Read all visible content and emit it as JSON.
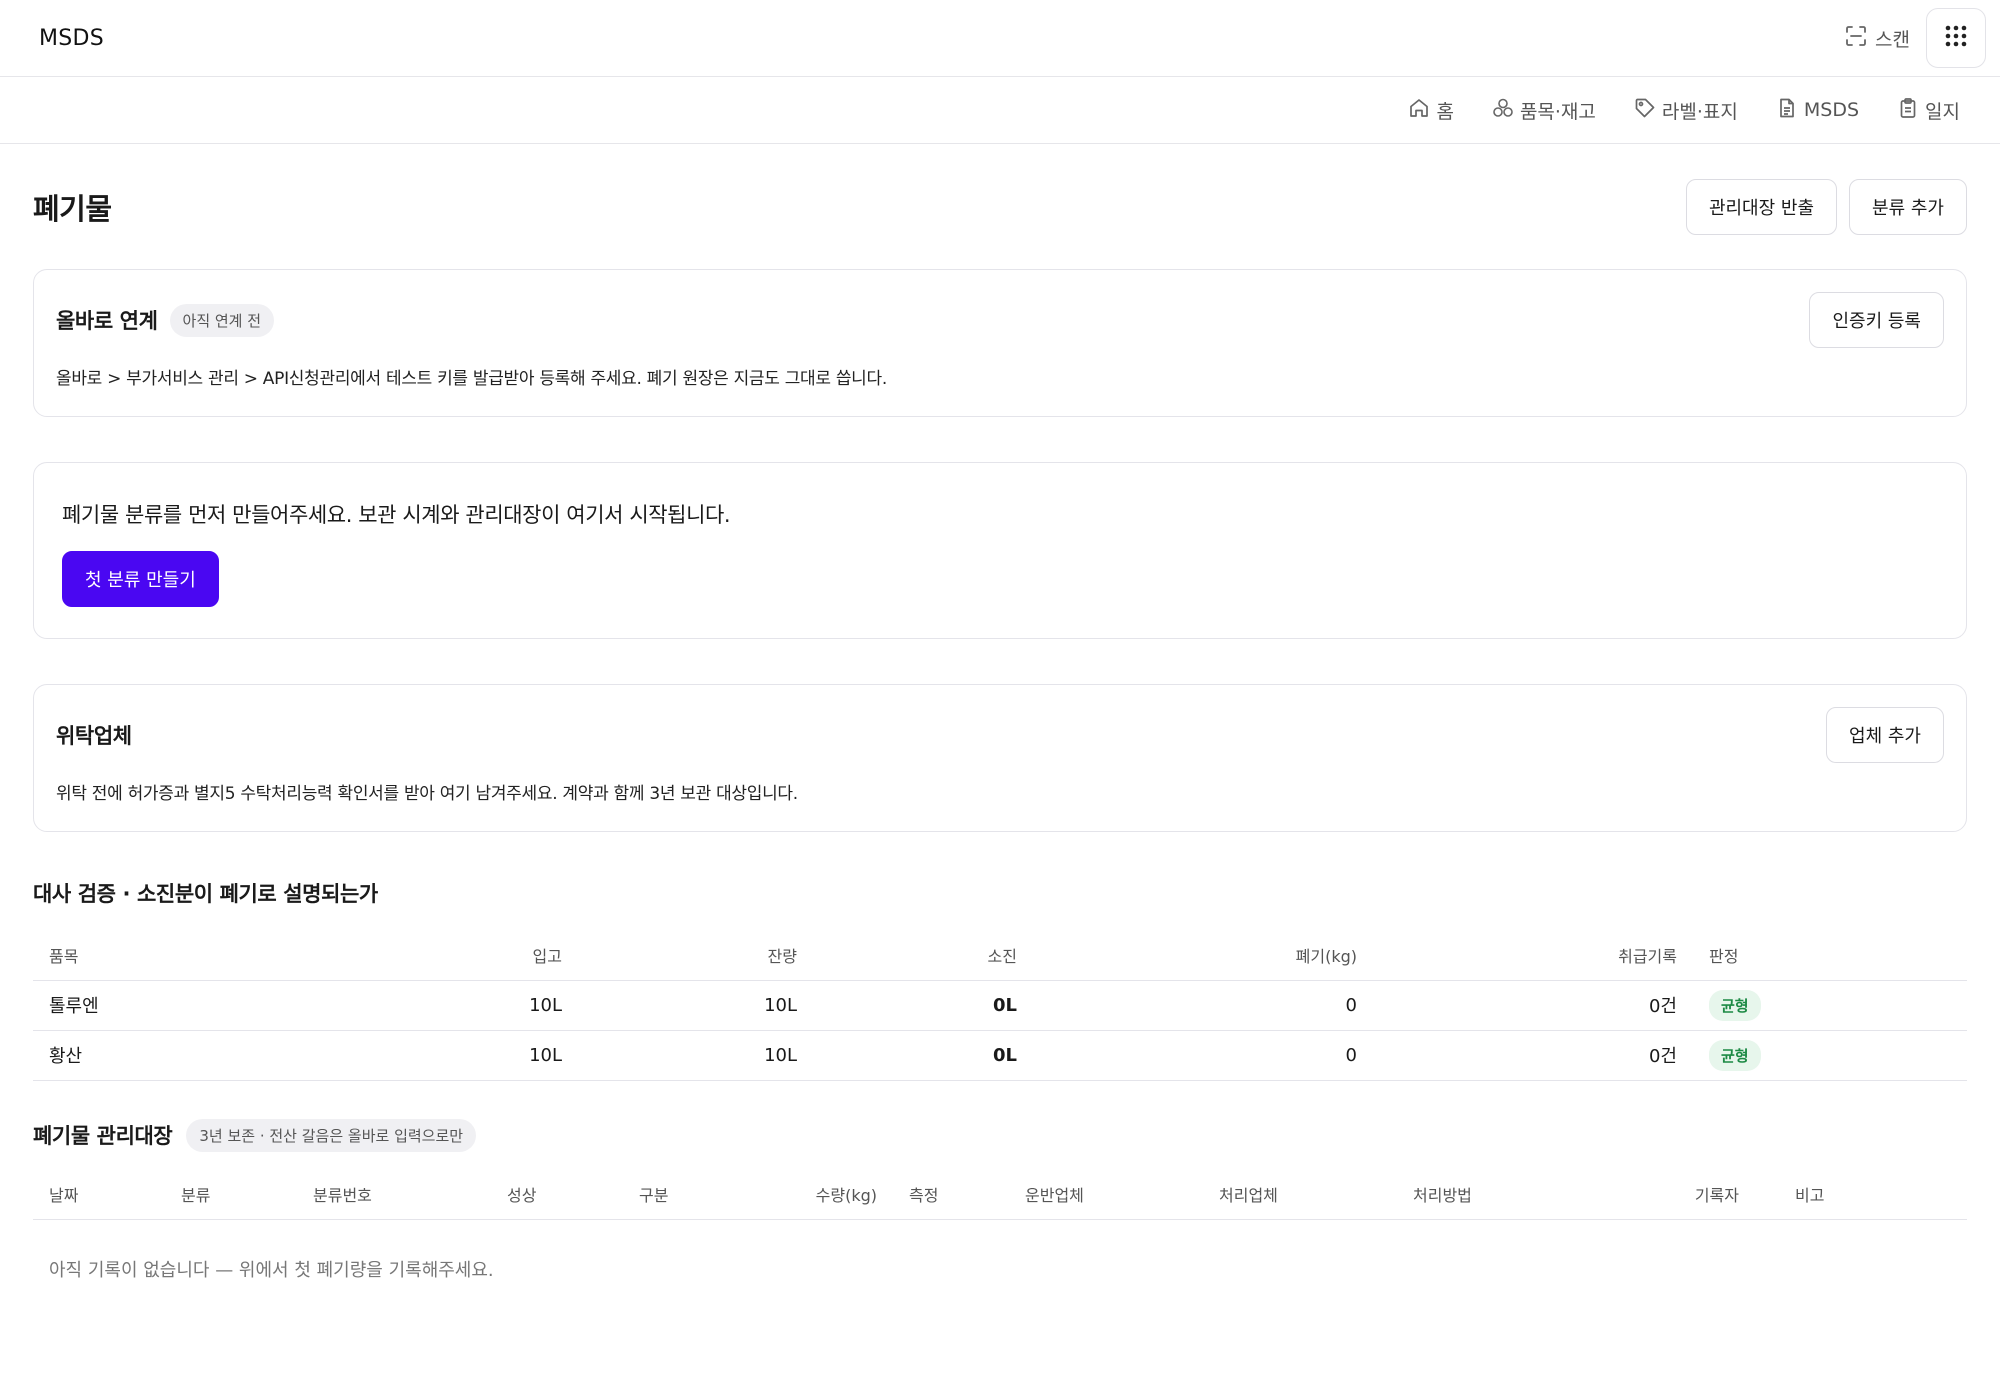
{
  "app": {
    "brand": "MSDS",
    "scan_label": "스캔"
  },
  "nav": {
    "items": [
      {
        "label": "홈",
        "icon": "home-icon"
      },
      {
        "label": "품목·재고",
        "icon": "boxes-icon"
      },
      {
        "label": "라벨·표지",
        "icon": "tag-icon"
      },
      {
        "label": "MSDS",
        "icon": "document-icon"
      },
      {
        "label": "일지",
        "icon": "clipboard-icon"
      }
    ]
  },
  "page": {
    "title": "폐기물",
    "export_label": "관리대장 반출",
    "add_category_label": "분류 추가"
  },
  "allbaro": {
    "title": "올바로 연계",
    "status": "아직 연계 전",
    "register_label": "인증키 등록",
    "description": "올바로 > 부가서비스 관리 > API신청관리에서 테스트 키를 발급받아 등록해 주세요. 폐기 원장은 지금도 그대로 씁니다."
  },
  "empty_category": {
    "message": "폐기물 분류를 먼저 만들어주세요. 보관 시계와 관리대장이 여기서 시작됩니다.",
    "cta_label": "첫 분류 만들기"
  },
  "vendor": {
    "title": "위탁업체",
    "add_label": "업체 추가",
    "description": "위탁 전에 허가증과 별지5 수탁처리능력 확인서를 받아 여기 남겨주세요. 계약과 함께 3년 보관 대상입니다."
  },
  "balance": {
    "title": "대사 검증 · 소진분이 폐기로 설명되는가",
    "headers": [
      "품목",
      "입고",
      "잔량",
      "소진",
      "폐기(kg)",
      "취급기록",
      "판정"
    ],
    "rows": [
      {
        "item": "톨루엔",
        "in": "10L",
        "remain": "10L",
        "used": "0L",
        "waste": "0",
        "records": "0건",
        "verdict": "균형"
      },
      {
        "item": "황산",
        "in": "10L",
        "remain": "10L",
        "used": "0L",
        "waste": "0",
        "records": "0건",
        "verdict": "균형"
      }
    ]
  },
  "ledger": {
    "title": "폐기물 관리대장",
    "note": "3년 보존 · 전산 갈음은 올바로 입력으로만",
    "headers": [
      "날짜",
      "분류",
      "분류번호",
      "성상",
      "구분",
      "수량(kg)",
      "측정",
      "운반업체",
      "처리업체",
      "처리방법",
      "기록자",
      "비고"
    ],
    "empty_message": "아직 기록이 없습니다 — 위에서 첫 폐기량을 기록해주세요."
  },
  "colors": {
    "primary": "#4a07f2",
    "ok_bg": "#e7f6ec",
    "ok_text": "#1d8a45",
    "border": "#e4e4ea"
  }
}
